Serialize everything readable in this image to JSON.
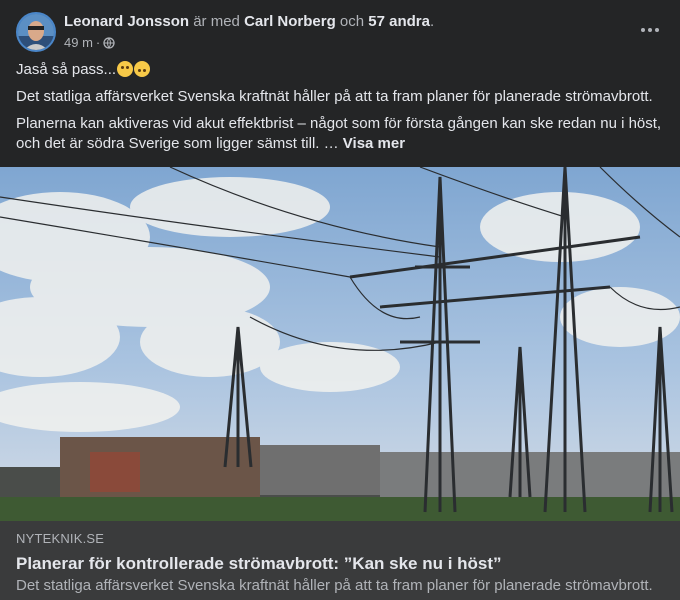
{
  "post": {
    "author": "Leonard Jonsson",
    "with_text": "är med",
    "tagged": "Carl Norberg",
    "and_text": "och",
    "others": "57 andra",
    "period": ".",
    "time": "49 m",
    "separator": "·",
    "audience_icon": "globe-icon",
    "menu_icon": "more-icon",
    "text": {
      "line1": "Jaså så pass...",
      "emoji1": "smirk-emoji",
      "emoji2": "upside-down-emoji",
      "line2": "Det statliga affärsverket Svenska kraftnät håller på att ta fram planer för planerade strömavbrott.",
      "line3": "Planerna kan aktiveras vid akut effektbrist – något som för första gången kan ske redan nu i höst, och det är södra Sverige som ligger sämst till. …",
      "see_more": "Visa mer"
    }
  },
  "link": {
    "domain": "NYTEKNIK.SE",
    "title": "Planerar för kontrollerade strömavbrott: ”Kan ske nu i höst”",
    "description": "Det statliga affärsverket Svenska kraftnät håller på att ta fram planer för planerade strömavbrott."
  },
  "colors": {
    "background": "#242526",
    "card": "#3a3b3c",
    "text": "#e4e6eb",
    "muted": "#b0b3b8"
  }
}
